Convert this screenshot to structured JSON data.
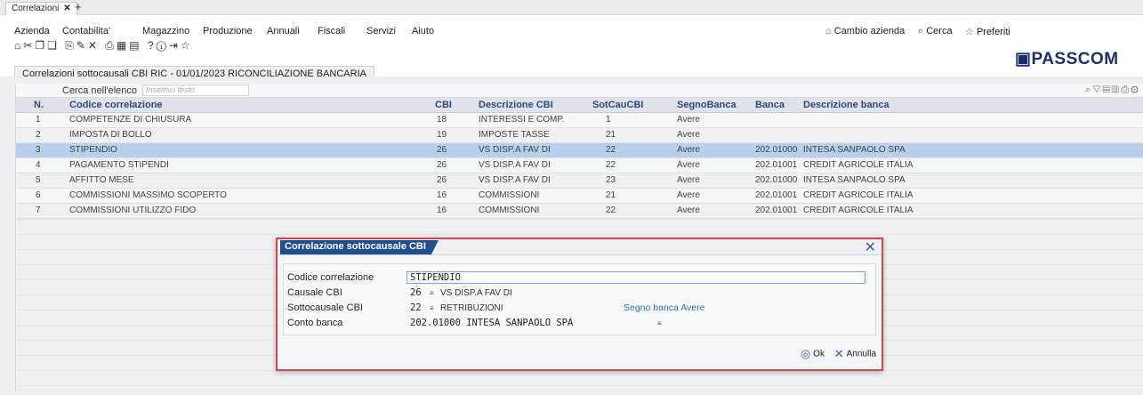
{
  "tab": {
    "label": "Correlazioni"
  },
  "menu": [
    "Azienda",
    "Contabilita'",
    "Magazzino",
    "Produzione",
    "Annuali",
    "Fiscali",
    "Servizi",
    "Aiuto"
  ],
  "right_links": {
    "cambio": "Cambio azienda",
    "cerca": "Cerca",
    "preferiti": "Preferiti"
  },
  "logo": "PASSCOM",
  "breadcrumb": "Correlazioni sottocausali CBI    RIC - 01/01/2023  RICONCILIAZIONE BANCARIA",
  "grid": {
    "search_label": "Cerca nell'elenco",
    "search_placeholder": "Inserisci testo",
    "columns": [
      "N.",
      "Codice correlazione",
      "CBI",
      "Descrizione CBI",
      "SotCauCBI",
      "SegnoBanca",
      "Banca",
      "Descrizione banca"
    ],
    "rows": [
      {
        "n": "1",
        "codice": "COMPETENZE DI CHIUSURA",
        "cbi": "18",
        "desc_cbi": "INTERESSI E COMP.",
        "sotcau": "1",
        "segno": "Avere",
        "banca": "",
        "desc_banca": ""
      },
      {
        "n": "2",
        "codice": "IMPOSTA DI BOLLO",
        "cbi": "19",
        "desc_cbi": "IMPOSTE TASSE",
        "sotcau": "21",
        "segno": "Avere",
        "banca": "",
        "desc_banca": ""
      },
      {
        "n": "3",
        "codice": "STIPENDIO",
        "cbi": "26",
        "desc_cbi": "VS DISP.A FAV DI",
        "sotcau": "22",
        "segno": "Avere",
        "banca": "202.01000",
        "desc_banca": "INTESA SANPAOLO SPA"
      },
      {
        "n": "4",
        "codice": "PAGAMENTO STIPENDI",
        "cbi": "26",
        "desc_cbi": "VS DISP.A FAV DI",
        "sotcau": "22",
        "segno": "Avere",
        "banca": "202.01001",
        "desc_banca": "CREDIT AGRICOLE ITALIA"
      },
      {
        "n": "5",
        "codice": "AFFITTO MESE",
        "cbi": "26",
        "desc_cbi": "VS DISP.A FAV DI",
        "sotcau": "23",
        "segno": "Avere",
        "banca": "202.01000",
        "desc_banca": "INTESA SANPAOLO SPA"
      },
      {
        "n": "6",
        "codice": "COMMISSIONI MASSIMO SCOPERTO",
        "cbi": "16",
        "desc_cbi": "COMMISSIONI",
        "sotcau": "21",
        "segno": "Avere",
        "banca": "202.01001",
        "desc_banca": "CREDIT AGRICOLE ITALIA"
      },
      {
        "n": "7",
        "codice": "COMMISSIONI UTILIZZO FIDO",
        "cbi": "16",
        "desc_cbi": "COMMISSIONI",
        "sotcau": "22",
        "segno": "Avere",
        "banca": "202.01001",
        "desc_banca": "CREDIT AGRICOLE ITALIA"
      }
    ]
  },
  "modal": {
    "title": "Correlazione sottocausale CBI",
    "fields": {
      "codice_label": "Codice correlazione",
      "codice_value": "STIPENDIO",
      "causale_label": "Causale CBI",
      "causale_code": "26",
      "causale_desc": "VS DISP.A FAV DI",
      "sotto_label": "Sottocausale CBI",
      "sotto_code": "22",
      "sotto_desc": "RETRIBUZIONI",
      "segno": "Segno banca Avere",
      "conto_label": "Conto banca",
      "conto_value": "202.01000 INTESA SANPAOLO SPA"
    },
    "buttons": {
      "ok": "Ok",
      "annulla": "Annulla"
    }
  }
}
